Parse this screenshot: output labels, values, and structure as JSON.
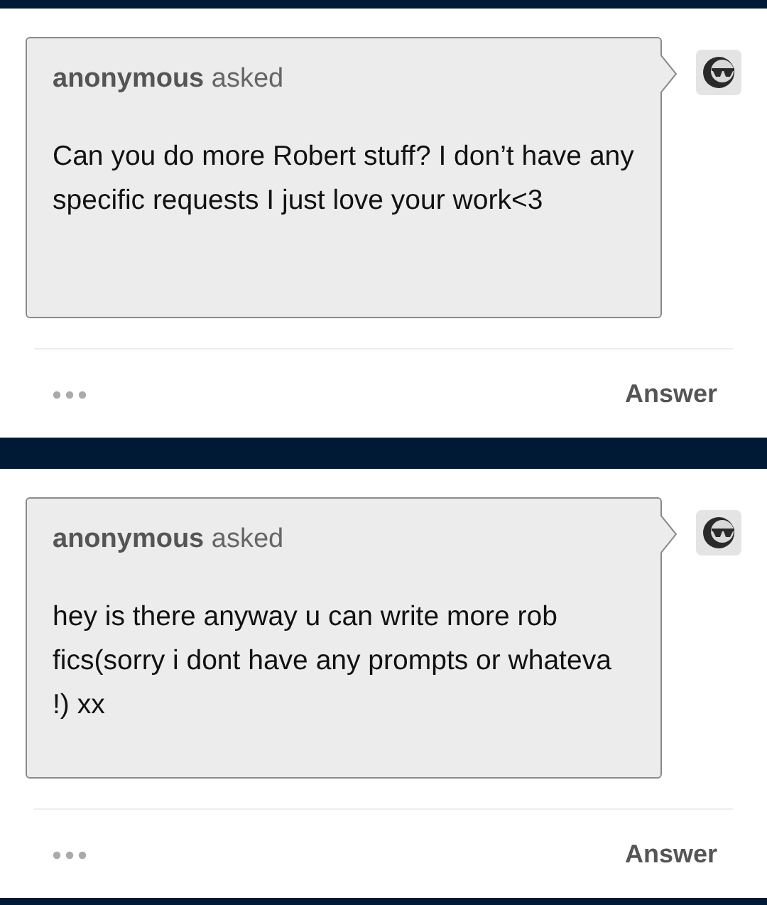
{
  "posts": [
    {
      "asker": "**anonymous** asked",
      "question": "Can you do more Robert stuff? I don’t have any specific requests I just love your work<3",
      "action": "Answer"
    },
    {
      "asker": "**anonymous** asked",
      "question": "hey is there anyway u can write more rob fics(sorry i dont have any prompts or whateva !) xx",
      "action": "Answer"
    }
  ]
}
